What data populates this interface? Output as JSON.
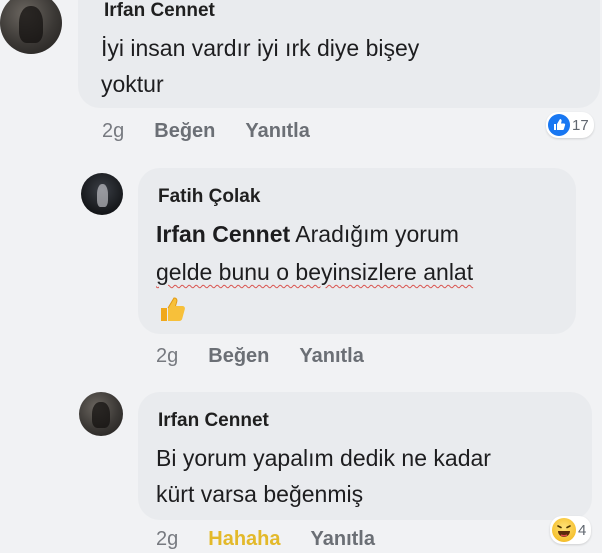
{
  "comments": [
    {
      "author": "Irfan Cennet",
      "line1": "İyi insan vardır iyi ırk diye bişey",
      "line2": "yoktur",
      "time": "2g",
      "like": "Beğen",
      "reply": "Yanıtla",
      "reaction": {
        "icon": "like-reaction-icon",
        "count": "17"
      }
    },
    {
      "author": "Fatih Çolak",
      "mention": "Irfan Cennet",
      "line1_rest": " Aradığım yorum",
      "line2": "gelde bunu o beyinsizlere anlat",
      "emoji": "thumbs-up-emoji",
      "time": "2g",
      "like": "Beğen",
      "reply": "Yanıtla"
    },
    {
      "author": "Irfan Cennet",
      "line1": "Bi yorum yapalım dedik ne kadar",
      "line2": "kürt varsa beğenmiş",
      "time": "2g",
      "like": "Hahaha",
      "reply": "Yanıtla",
      "reaction": {
        "icon": "haha-reaction-icon",
        "count": "4"
      }
    }
  ],
  "colors": {
    "bubble": "#e9ebee",
    "like_blue": "#1877f2",
    "haha_yellow": "#e3b92a",
    "meta_gray": "#6b6f75"
  }
}
